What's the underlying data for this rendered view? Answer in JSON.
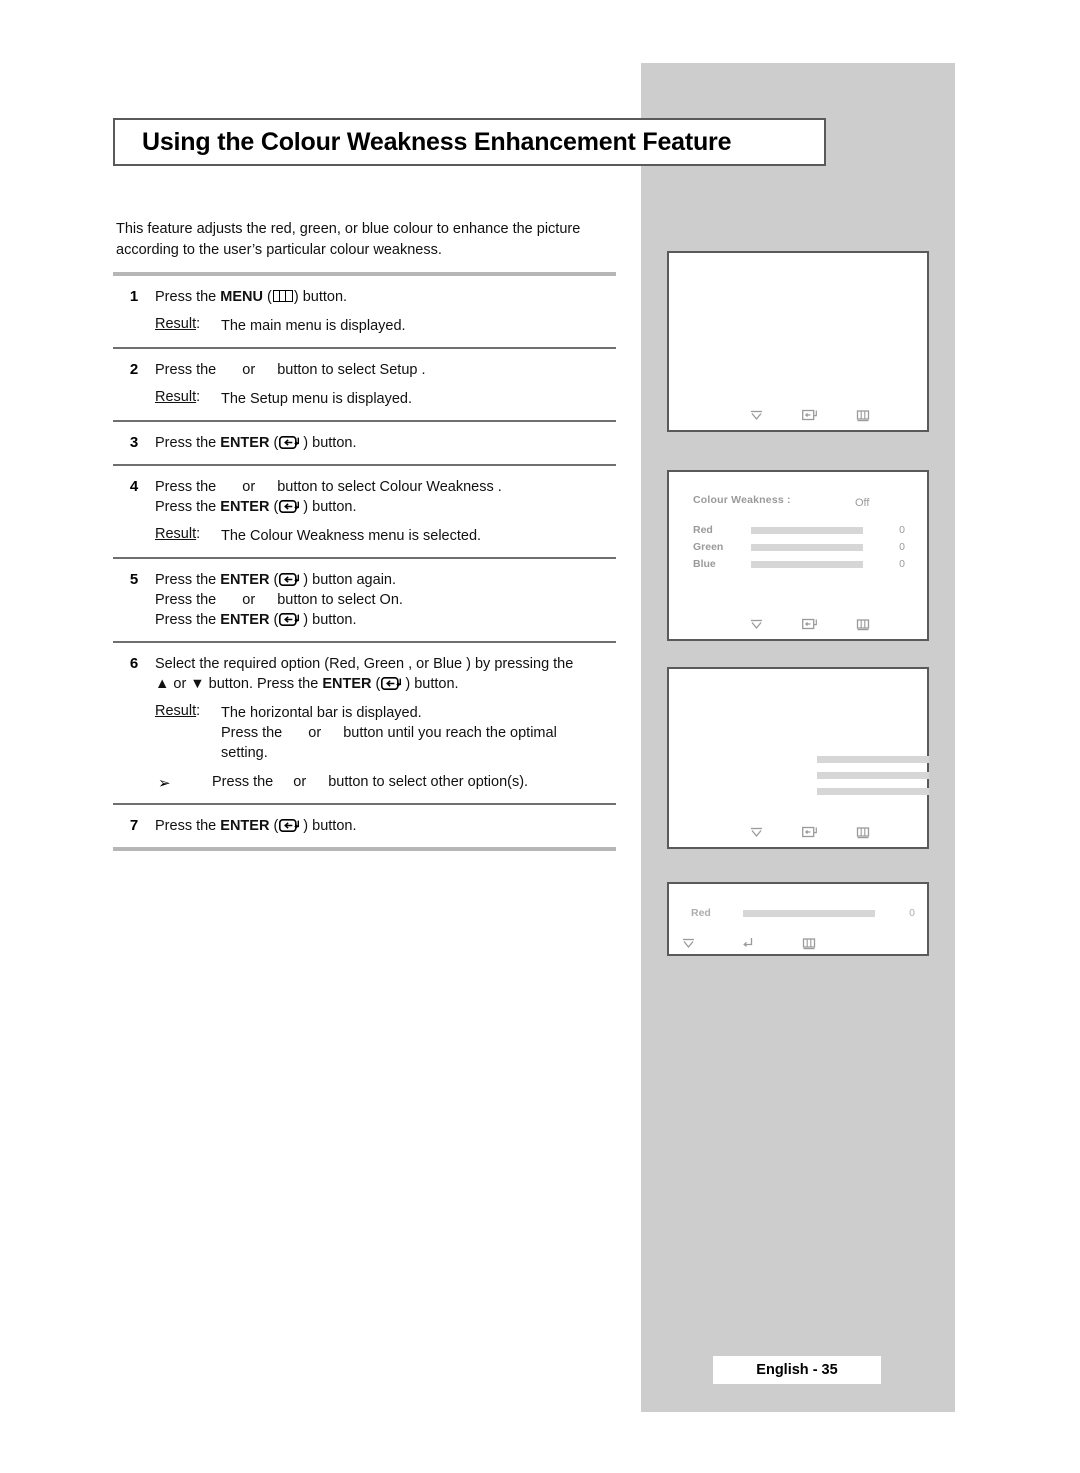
{
  "document": {
    "title": "Using the Colour Weakness Enhancement Feature",
    "intro": "This feature adjusts the red, green, or blue colour to enhance the picture according to the user’s particular colour weakness.",
    "footer_page": "English - 35"
  },
  "steps": [
    {
      "num": "1",
      "lines": [
        {
          "pre": "Press the ",
          "bold": "MENU",
          "mid": " (",
          "icon": "menu-icon",
          "post": ") button."
        }
      ],
      "result_label": "Result",
      "result_colon": ":",
      "result_lines": [
        "The main menu is displayed."
      ]
    },
    {
      "num": "2",
      "lines": [
        {
          "pre": "Press the ",
          "gap1": true,
          "mid": "or",
          "gap2": true,
          "post": "button to select Setup ."
        }
      ],
      "result_label": "Result",
      "result_colon": ":",
      "result_lines": [
        "The Setup  menu is displayed."
      ]
    },
    {
      "num": "3",
      "lines": [
        {
          "pre": "Press the ",
          "bold": "ENTER",
          "mid": " (",
          "icon": "enter-icon",
          "post": ") button."
        }
      ],
      "result_label": "",
      "result_colon": "",
      "result_lines": []
    },
    {
      "num": "4",
      "lines": [
        {
          "pre": "Press the ",
          "gap1": true,
          "mid": "or",
          "gap2": true,
          "post": "button to select Colour Weakness   ."
        },
        {
          "pre": "Press the ",
          "bold": "ENTER",
          "mid": " (",
          "icon": "enter-icon",
          "post": ") button."
        }
      ],
      "result_label": "Result",
      "result_colon": ":",
      "result_lines": [
        "The Colour Weakness     menu is selected."
      ]
    },
    {
      "num": "5",
      "lines": [
        {
          "pre": "Press the ",
          "bold": "ENTER",
          "mid": " (",
          "icon": "enter-icon",
          "post": ") button again."
        },
        {
          "pre": "Press the ",
          "gap1": true,
          "mid": "or",
          "gap2": true,
          "post": "button to select On."
        },
        {
          "pre": "Press the ",
          "bold": "ENTER",
          "mid": " (",
          "icon": "enter-icon",
          "post": ") button."
        }
      ],
      "result_label": "",
      "result_colon": "",
      "result_lines": []
    },
    {
      "num": "6",
      "lines": [
        {
          "plain": "Select the required option (Red, Green , or Blue ) by pressing the"
        },
        {
          "pre": "▲ or ▼ button. Press the ",
          "bold": "ENTER",
          "mid": " (",
          "icon": "enter-icon",
          "post": ") button."
        }
      ],
      "result_label": "Result",
      "result_colon": ":",
      "result_lines": [
        "The horizontal bar is displayed.",
        "PRESS_OR_OPTIMAL",
        "setting."
      ],
      "result_or_line": {
        "pre": "Press the ",
        "mid": "or",
        "post": "button until you reach the optimal"
      },
      "note": {
        "arrow": "➢",
        "pre": "Press the ",
        "mid": "or",
        "post": "button to select other option(s)."
      }
    },
    {
      "num": "7",
      "lines": [
        {
          "pre": "Press the ",
          "bold": "ENTER",
          "mid": " (",
          "icon": "enter-icon",
          "post": ") button."
        }
      ],
      "result_label": "",
      "result_colon": "",
      "result_lines": []
    }
  ],
  "osd_screens": [
    {
      "name": "main-menu-screen",
      "header": "",
      "header_value": "",
      "rows": [],
      "footer_icons": [
        "down-arrow-icon",
        "enter-icon",
        "menu-icon"
      ]
    },
    {
      "name": "colour-weakness-screen",
      "header": "Colour Weakness :",
      "header_value": "Off",
      "rows": [
        {
          "label": "Red",
          "value": "0"
        },
        {
          "label": "Green",
          "value": "0"
        },
        {
          "label": "Blue",
          "value": "0"
        }
      ],
      "footer_icons": [
        "down-arrow-icon",
        "enter-icon",
        "menu-icon"
      ]
    },
    {
      "name": "bars-only-screen",
      "header": "",
      "header_value": "",
      "rows": [
        {
          "label": "",
          "value": ""
        },
        {
          "label": "",
          "value": ""
        },
        {
          "label": "",
          "value": ""
        }
      ],
      "footer_icons": [
        "down-arrow-icon",
        "enter-icon",
        "menu-icon"
      ]
    },
    {
      "name": "red-adjust-screen",
      "header": "",
      "header_value": "",
      "single_row": {
        "label": "Red",
        "value": "0"
      },
      "footer_icons": [
        "down-arrow-icon",
        "enter-return-icon",
        "menu-icon"
      ]
    }
  ],
  "colors": {
    "panel_grey": "#cdcdcd",
    "rule_grey": "#b6b6b6",
    "rule_dark": "#6f6f6f",
    "osd_text": "#9a9a9a",
    "osd_bar": "#d6d6d6",
    "border": "#5a5a5a"
  }
}
